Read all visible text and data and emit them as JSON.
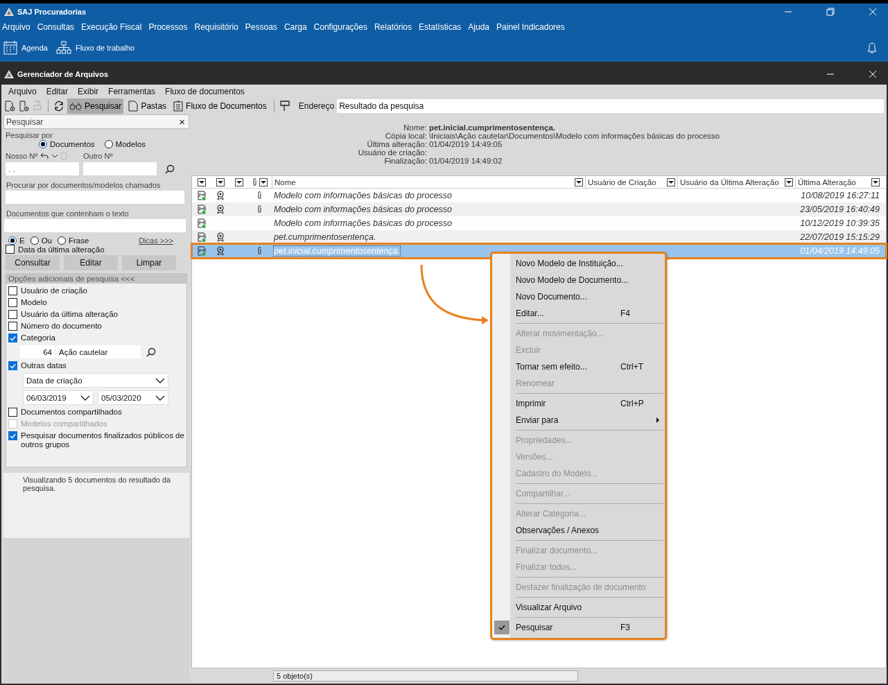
{
  "app": {
    "title": "SAJ Procuradorias",
    "menu": [
      "Arquivo",
      "Consultas",
      "Execução Fiscal",
      "Processos",
      "Requisitório",
      "Pessoas",
      "Carga",
      "Configurações",
      "Relatórios",
      "Estatísticas",
      "Ajuda",
      "Painel Indicadores"
    ],
    "toolbar": [
      "Agenda",
      "Fluxo de trabalho"
    ]
  },
  "window": {
    "title": "Gerenciador de Arquivos",
    "menu": [
      "Arquivo",
      "Editar",
      "Exibir",
      "Ferramentas",
      "Fluxo de documentos"
    ],
    "toolbar": [
      {
        "label": "Pesquisar",
        "selected": true,
        "kind": "search"
      },
      {
        "label": "Pastas",
        "selected": false,
        "kind": "folders"
      },
      {
        "label": "Fluxo de Documentos",
        "selected": false,
        "kind": "flow"
      }
    ],
    "address_label": "Endereço",
    "address": "Resultado da pesquisa"
  },
  "search_panel": {
    "title": "Pesquisar",
    "close": "×",
    "search_by_label": "Pesquisar por",
    "search_by": [
      {
        "label": "Documentos",
        "selected": true
      },
      {
        "label": "Modelos",
        "selected": false
      }
    ],
    "our_no_label": "Nosso Nº",
    "our_no_value": ". .",
    "other_no_label": "Outro Nº",
    "name_label": "Procurar por documentos/modelos chamados",
    "text_label": "Documentos que contenham o texto",
    "match": [
      {
        "label": "E",
        "selected": true
      },
      {
        "label": "Ou",
        "selected": false
      },
      {
        "label": "Frase",
        "selected": false
      }
    ],
    "tips": "Dicas >>>",
    "last_change": {
      "label": "Data da última alteração",
      "checked": false
    },
    "buttons": [
      "Consultar",
      "Editar",
      "Limpar"
    ],
    "more_title": "Opções adicionais de pesquisa <<<",
    "options": [
      {
        "kind": "checkbox",
        "label": "Usuário de criação",
        "checked": false
      },
      {
        "kind": "checkbox",
        "label": "Modelo",
        "checked": false
      },
      {
        "kind": "checkbox",
        "label": "Usuário da última alteração",
        "checked": false
      },
      {
        "kind": "checkbox",
        "label": "Número do documento",
        "checked": false
      },
      {
        "kind": "checkbox",
        "label": "Categoria",
        "checked": true
      },
      {
        "kind": "category",
        "code": "64",
        "name": "Ação cautelar"
      },
      {
        "kind": "checkbox",
        "label": "Outras datas",
        "checked": true
      },
      {
        "kind": "dates",
        "type": "Data de criação",
        "from": "06/03/2019",
        "to": "05/03/2020"
      },
      {
        "kind": "checkbox",
        "label": "Documentos compartilhados",
        "checked": false
      },
      {
        "kind": "checkbox",
        "label": "Modelos compartilhados",
        "checked": false,
        "disabled": true
      },
      {
        "kind": "checkbox",
        "label": "Pesquisar documentos finalizados públicos de outros grupos",
        "checked": true
      }
    ],
    "summary": "Visualizando 5 documentos do resultado da pesquisa."
  },
  "details": [
    {
      "label": "Nome:",
      "value": "pet.inicial.cumprimentosentença.",
      "bold": true
    },
    {
      "label": "Cópia local:",
      "value": "\\Iniciais\\Ação cautelar\\Documentos\\Modelo com informações básicas do processo"
    },
    {
      "label": "Última alteração:",
      "value": "01/04/2019 14:49:05"
    },
    {
      "label": "Usuário de criação:"
    },
    {
      "label": "Finalização:",
      "value": "01/04/2019 14:49:02"
    }
  ],
  "table": {
    "columns": [
      "Nome",
      "Usuário de Criação",
      "Usuário da Última Alteração",
      "Última Alteração"
    ],
    "rows": [
      {
        "name": "Modelo com informações básicas do processo",
        "date": "10/08/2019 16:27:11",
        "award": true,
        "attachment": true,
        "selected": false
      },
      {
        "name": "Modelo com informações básicas do processo",
        "date": "23/05/2019 16:40:49",
        "award": true,
        "attachment": true,
        "selected": false
      },
      {
        "name": "Modelo com informações básicas do processo",
        "date": "10/12/2019 10:39:35",
        "award": false,
        "attachment": false,
        "selected": false
      },
      {
        "name": "pet.cumprimentosentença.",
        "date": "22/07/2019 15:15:29",
        "award": true,
        "attachment": false,
        "selected": false
      },
      {
        "name": "pet.inicial.cumprimentosentença.",
        "date": "01/04/2019 14:49:05",
        "award": true,
        "attachment": true,
        "selected": true
      }
    ]
  },
  "status": "5 objeto(s)",
  "context_menu": [
    [
      {
        "label": "Novo Modelo de Instituição...",
        "disabled": false
      },
      {
        "label": "Novo Modelo de Documento...",
        "disabled": false
      },
      {
        "label": "Novo Documento...",
        "disabled": false
      },
      {
        "label": "Editar...",
        "shortcut": "F4",
        "disabled": false
      }
    ],
    [
      {
        "label": "Alterar movimentação...",
        "disabled": true
      },
      {
        "label": "Excluir",
        "disabled": true
      },
      {
        "label": "Tornar sem efeito...",
        "shortcut": "Ctrl+T",
        "disabled": false
      },
      {
        "label": "Renomear",
        "disabled": true
      }
    ],
    [
      {
        "label": "Imprimir",
        "shortcut": "Ctrl+P",
        "disabled": false
      },
      {
        "label": "Enviar para",
        "submenu": true,
        "disabled": false
      }
    ],
    [
      {
        "label": "Propriedades...",
        "disabled": true
      },
      {
        "label": "Versões...",
        "disabled": true
      },
      {
        "label": "Cadastro do Modelo...",
        "disabled": true
      }
    ],
    [
      {
        "label": "Compartilhar...",
        "disabled": true
      }
    ],
    [
      {
        "label": "Alterar Categoria...",
        "disabled": true
      },
      {
        "label": "Observações / Anexos",
        "disabled": false
      }
    ],
    [
      {
        "label": "Finalizar documento...",
        "disabled": true
      },
      {
        "label": "Finalizar todos...",
        "disabled": true
      }
    ],
    [
      {
        "label": "Desfazer finalização de documento",
        "disabled": true
      }
    ],
    [
      {
        "label": "Visualizar Arquivo",
        "disabled": false
      }
    ],
    [
      {
        "label": "Pesquisar",
        "shortcut": "F3",
        "checked": true,
        "disabled": false
      }
    ]
  ]
}
